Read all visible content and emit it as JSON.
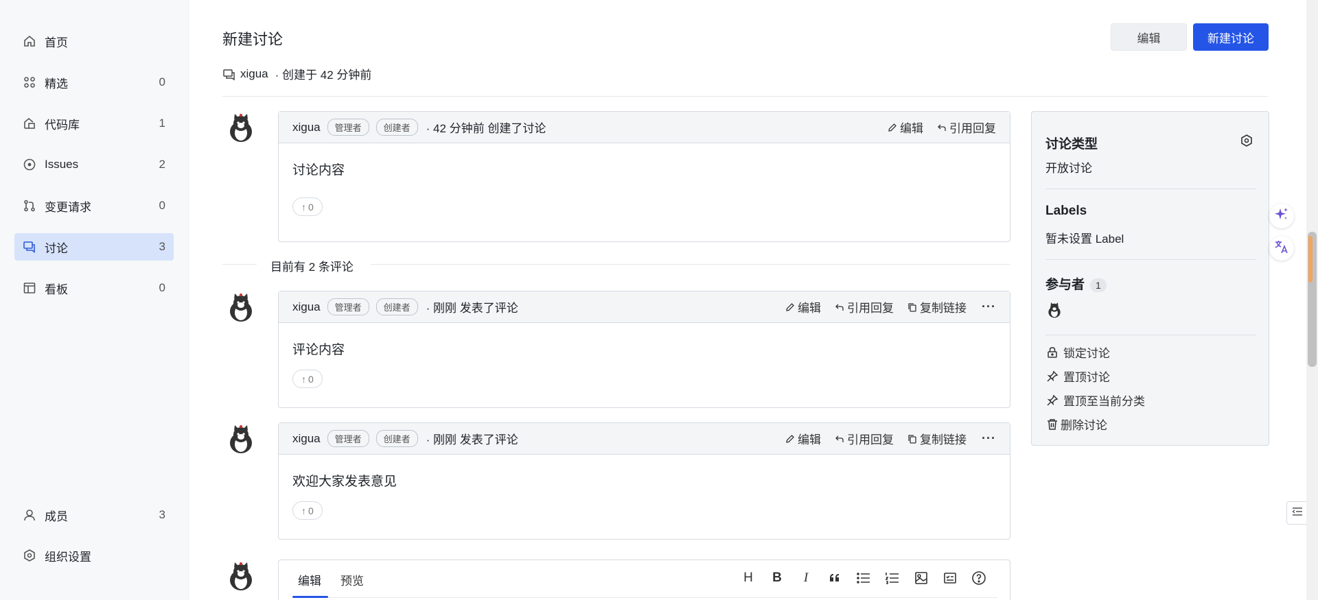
{
  "sidebar": {
    "items": [
      {
        "label": "首页",
        "count": "",
        "icon": "home-icon"
      },
      {
        "label": "精选",
        "count": "0",
        "icon": "featured-icon"
      },
      {
        "label": "代码库",
        "count": "1",
        "icon": "repo-icon"
      },
      {
        "label": "Issues",
        "count": "2",
        "icon": "issue-icon"
      },
      {
        "label": "变更请求",
        "count": "0",
        "icon": "merge-request-icon"
      },
      {
        "label": "讨论",
        "count": "3",
        "icon": "discussion-icon"
      },
      {
        "label": "看板",
        "count": "0",
        "icon": "board-icon"
      }
    ],
    "bottom": [
      {
        "label": "成员",
        "count": "3",
        "icon": "user-icon"
      },
      {
        "label": "组织设置",
        "count": "",
        "icon": "settings-icon"
      }
    ]
  },
  "header": {
    "title": "新建讨论",
    "author": "xigua",
    "created": "· 创建于 42 分钟前",
    "edit_label": "编辑",
    "new_label": "新建讨论"
  },
  "roles": {
    "admin": "管理者",
    "creator": "创建者"
  },
  "actions": {
    "edit": "编辑",
    "quote": "引用回复",
    "copy_link": "复制链接",
    "more": "···"
  },
  "original_post": {
    "author": "xigua",
    "when": "· 42 分钟前 创建了讨论",
    "content": "讨论内容",
    "votes": "0"
  },
  "comment_count_text": "目前有 2 条评论",
  "comments": [
    {
      "author": "xigua",
      "when": "· 刚刚 发表了评论",
      "content": "评论内容",
      "votes": "0"
    },
    {
      "author": "xigua",
      "when": "· 刚刚 发表了评论",
      "content": "欢迎大家发表意见",
      "votes": "0"
    }
  ],
  "editor": {
    "tab_edit": "编辑",
    "tab_preview": "预览",
    "tools": [
      "H",
      "B",
      "I"
    ]
  },
  "panel": {
    "type_title": "讨论类型",
    "type_value": "开放讨论",
    "labels_title": "Labels",
    "labels_value": "暂未设置 Label",
    "participants_title": "参与者",
    "participants_count": "1",
    "lock": "锁定讨论",
    "pin": "置顶讨论",
    "pin_category": "置顶至当前分类",
    "delete": "删除讨论"
  },
  "colors": {
    "accent": "#2455e6",
    "active_nav_bg": "#d7e3fb"
  }
}
